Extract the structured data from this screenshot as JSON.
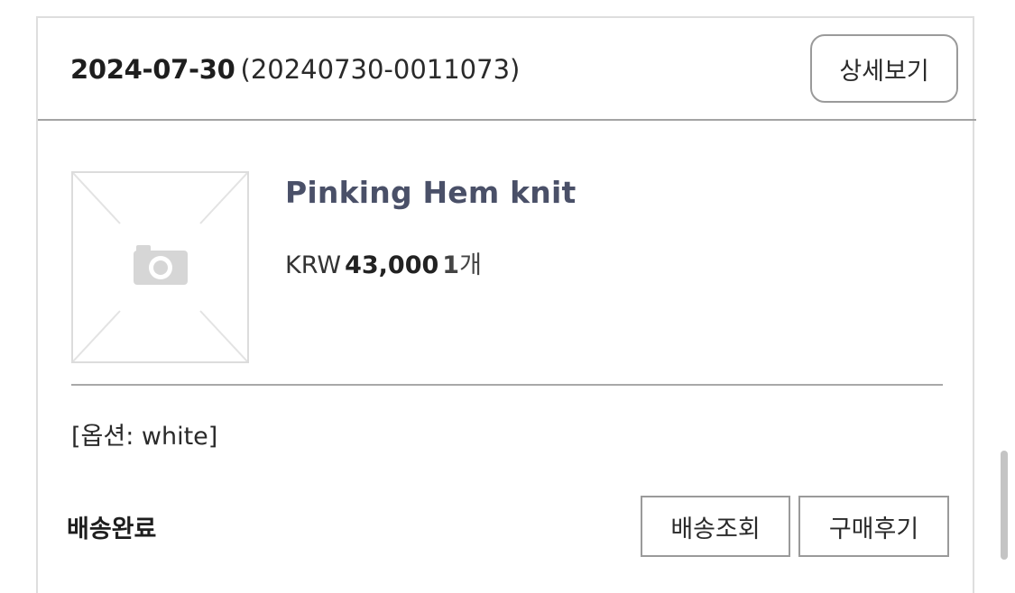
{
  "order": {
    "date": "2024-07-30",
    "number": "(20240730-0011073)",
    "detail_button": "상세보기"
  },
  "product": {
    "name": "Pinking Hem knit",
    "currency": "KRW",
    "price": "43,000",
    "quantity": "1",
    "quantity_unit": "개",
    "thumbnail_icon": "camera-placeholder-icon",
    "option": "[옵션: white]"
  },
  "delivery": {
    "status": "배송완료",
    "track_button": "배송조회",
    "review_button": "구매후기"
  }
}
